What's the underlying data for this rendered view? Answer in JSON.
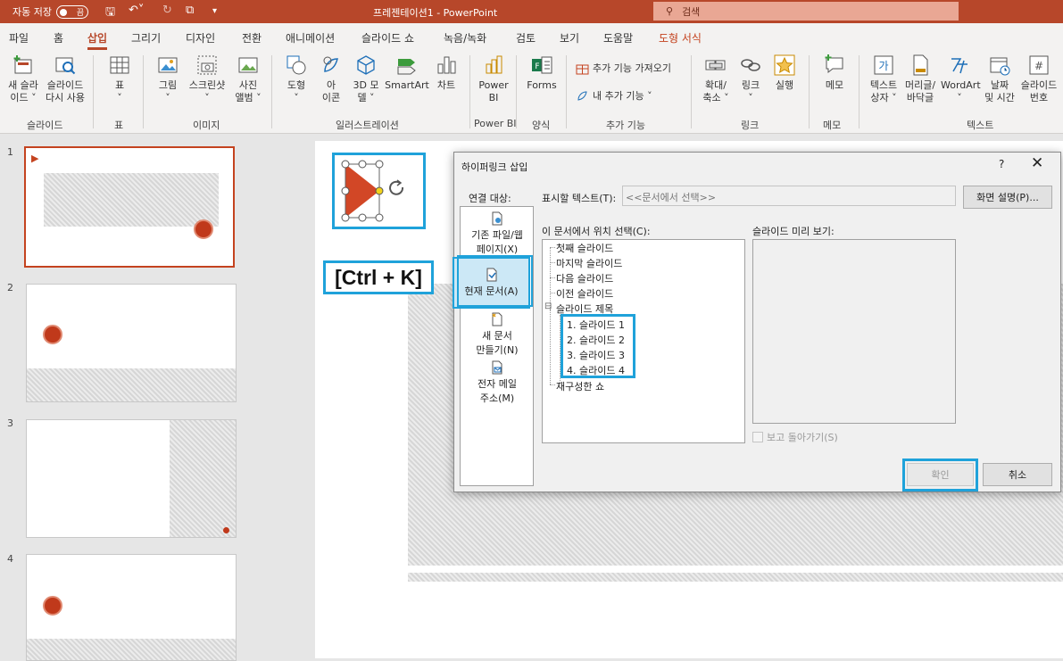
{
  "titlebar": {
    "autosave_label": "자동 저장",
    "autosave_state": "끔",
    "doc_title": "프레젠테이션1  -  PowerPoint",
    "search_placeholder": "검색"
  },
  "tabs": [
    "파일",
    "홈",
    "삽입",
    "그리기",
    "디자인",
    "전환",
    "애니메이션",
    "슬라이드 쇼",
    "녹음/녹화",
    "검토",
    "보기",
    "도움말",
    "도형 서식"
  ],
  "ribbon": {
    "new_slide": [
      "새 슬라",
      "이드 ˅"
    ],
    "reuse_slide": [
      "슬라이드",
      "다시 사용"
    ],
    "table": [
      "표",
      "˅"
    ],
    "picture": [
      "그림",
      "˅"
    ],
    "screenshot": [
      "스크린샷",
      "˅"
    ],
    "photo_album": [
      "사진",
      "앨범 ˅"
    ],
    "shapes": [
      "도형",
      "˅"
    ],
    "icons": [
      "아",
      "이콘"
    ],
    "models3d": [
      "3D 모",
      "델 ˅"
    ],
    "smartart": "SmartArt",
    "chart": "차트",
    "powerbi": [
      "Power",
      "BI"
    ],
    "forms": "Forms",
    "get_addins": "추가 기능 가져오기",
    "my_addins": "내 추가 기능  ˅",
    "zoom": [
      "확대/",
      "축소 ˅"
    ],
    "link": [
      "링크",
      "˅"
    ],
    "action": "실행",
    "comment": "메모",
    "textbox": [
      "텍스트",
      "상자 ˅"
    ],
    "header_footer": [
      "머리글/",
      "바닥글"
    ],
    "wordart": [
      "WordArt",
      "˅"
    ],
    "datetime": [
      "날짜",
      "및 시간"
    ],
    "slide_number": [
      "슬라이드",
      "번호"
    ],
    "groups": [
      "슬라이드",
      "표",
      "이미지",
      "일러스트레이션",
      "Power BI",
      "양식",
      "추가 기능",
      "링크",
      "메모",
      "텍스트"
    ]
  },
  "thumbnails": [
    "1",
    "2",
    "3",
    "4"
  ],
  "annotation": "[Ctrl + K]",
  "dialog": {
    "title": "하이퍼링크 삽입",
    "help": "?",
    "close": "✕",
    "link_to_label": "연결 대상:",
    "link_targets": [
      [
        "기존 파일/웹",
        "페이지(X)"
      ],
      [
        "현재 문서(A)"
      ],
      [
        "새 문서",
        "만들기(N)"
      ],
      [
        "전자 메일",
        "주소(M)"
      ]
    ],
    "display_text_label": "표시할 텍스트(T):",
    "display_text_value": "<<문서에서 선택>>",
    "screentip_button": "화면 설명(P)...",
    "place_label": "이 문서에서 위치 선택(C):",
    "tree": {
      "first": "첫째 슬라이드",
      "last": "마지막 슬라이드",
      "next": "다음 슬라이드",
      "previous": "이전 슬라이드",
      "titles_group": "슬라이드 제목",
      "collapse": "⊟",
      "slides": [
        "1. 슬라이드 1",
        "2. 슬라이드 2",
        "3. 슬라이드 3",
        "4. 슬라이드 4"
      ],
      "custom_shows": "재구성한 쇼"
    },
    "preview_label": "슬라이드 미리 보기:",
    "show_return_label": "보고 돌아가기(S)",
    "ok_button": "확인",
    "cancel_button": "취소"
  },
  "colors": {
    "brand": "#b7472a",
    "highlight": "#1fa2da",
    "shape_fill": "#d24726"
  }
}
